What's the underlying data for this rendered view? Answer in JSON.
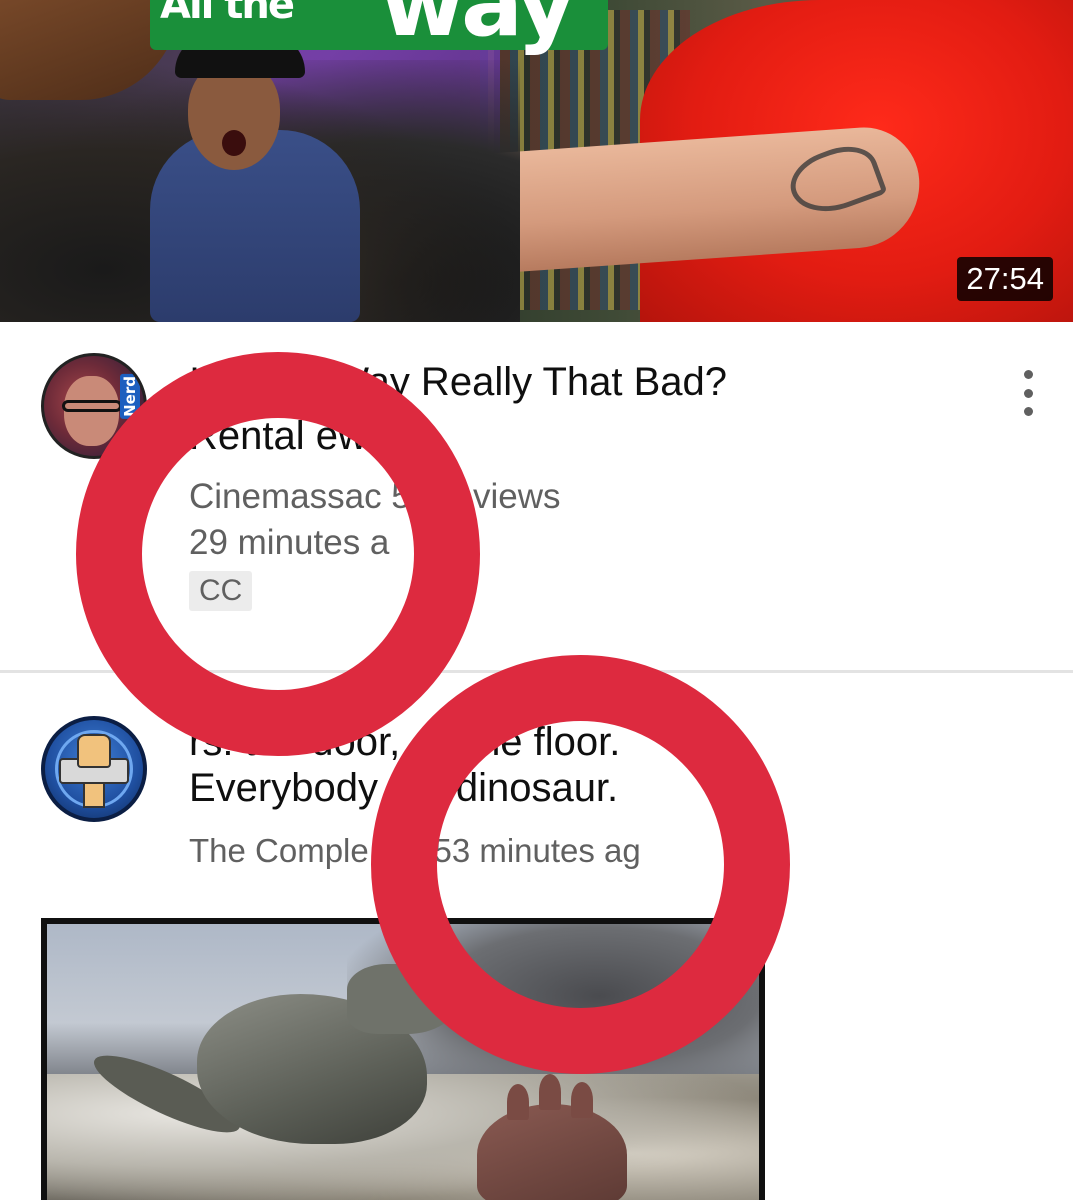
{
  "video1": {
    "thumbnail_title_art_left": "All the",
    "thumbnail_title_art_right": "way",
    "duration": "27:54",
    "title_line1": "I All the Way Really That Bad?",
    "title_line2": "Rental ews",
    "channel_views": "Cinemassac 5.7K views",
    "posted": "29 minutes a",
    "cc_label": "CC",
    "avatar_tag": "Nerd"
  },
  "post2": {
    "title_line1": "rs: the door, on the floor.",
    "title_line2": "Everybody the dinosaur.",
    "meta": "The Comple st • 53 minutes ag"
  },
  "colors": {
    "annotation_red": "#dd2a3f",
    "meta_gray": "#606060"
  },
  "icons": {
    "more_menu": "vertical-ellipsis-icon"
  }
}
